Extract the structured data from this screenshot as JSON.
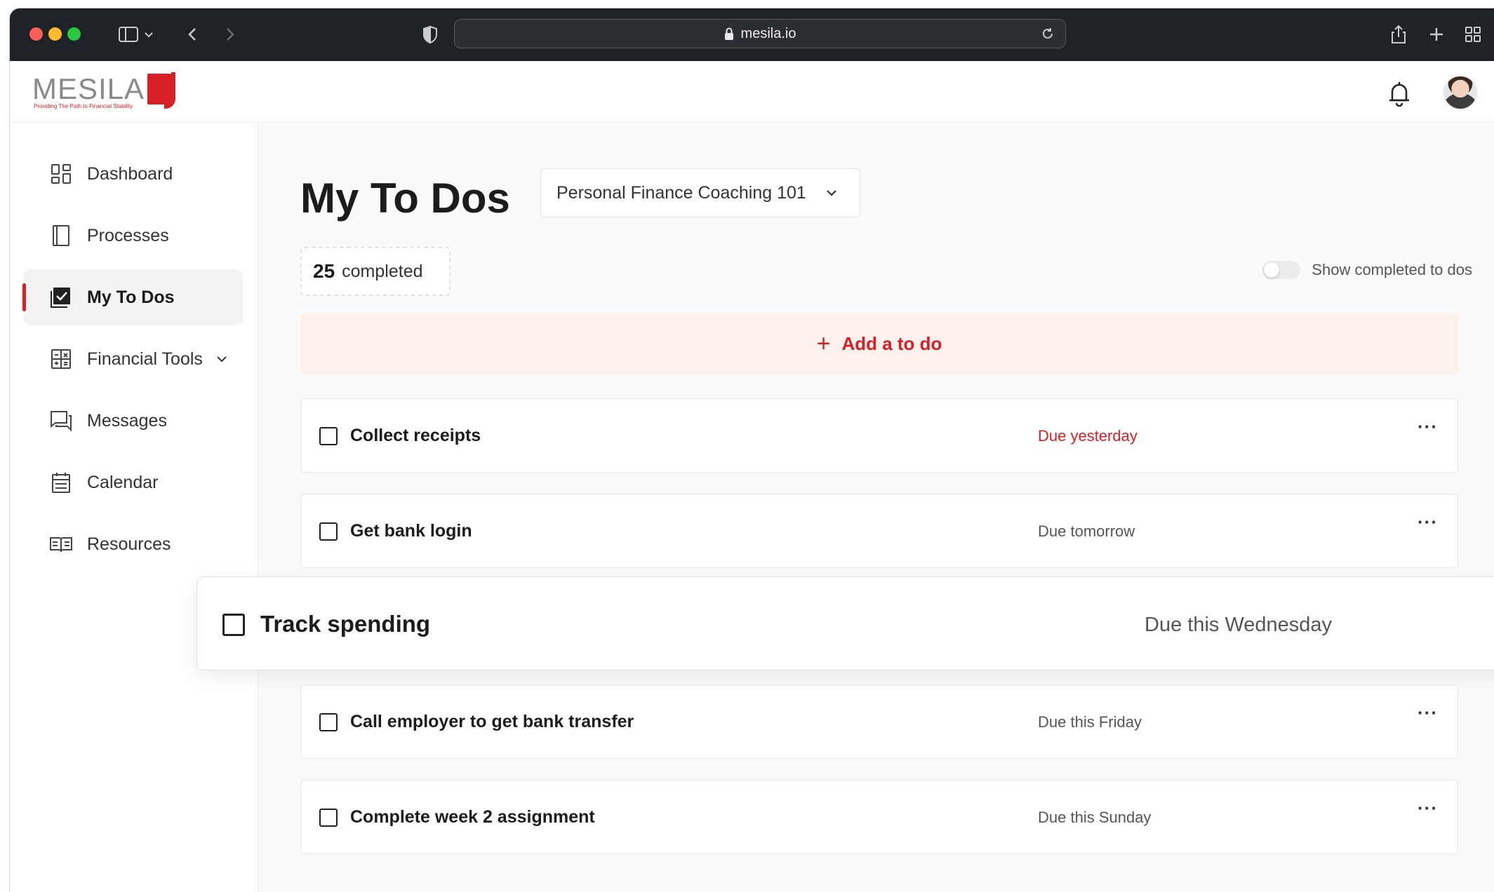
{
  "browser": {
    "url": "mesila.io"
  },
  "brand": {
    "name": "MESILA",
    "tagline": "Providing The Path to Financial Stability",
    "accent": "#d71f26"
  },
  "sidebar": {
    "items": [
      {
        "label": "Dashboard",
        "icon": "dashboard-grid-icon"
      },
      {
        "label": "Processes",
        "icon": "book-icon"
      },
      {
        "label": "My To Dos",
        "icon": "checked-board-icon",
        "active": true
      },
      {
        "label": "Financial Tools",
        "icon": "calculator-icon",
        "expandable": true
      },
      {
        "label": "Messages",
        "icon": "chat-icon"
      },
      {
        "label": "Calendar",
        "icon": "calendar-icon"
      },
      {
        "label": "Resources",
        "icon": "open-book-icon"
      }
    ]
  },
  "main": {
    "title": "My To Dos",
    "program_select": "Personal Finance Coaching 101",
    "completed_count": "25",
    "completed_label": "completed",
    "toggle_label": "Show completed to dos",
    "add_label": "Add a to do",
    "todos": [
      {
        "title": "Collect receipts",
        "due": "Due yesterday",
        "overdue": true
      },
      {
        "title": "Get bank login",
        "due": "Due tomorrow"
      },
      {
        "title": "Call employer to get bank transfer",
        "due": "Due this Friday"
      },
      {
        "title": "Complete week 2 assignment",
        "due": "Due this Sunday"
      }
    ],
    "dragging": {
      "title": "Track spending",
      "due": "Due this Wednesday"
    },
    "more_label": "···"
  }
}
